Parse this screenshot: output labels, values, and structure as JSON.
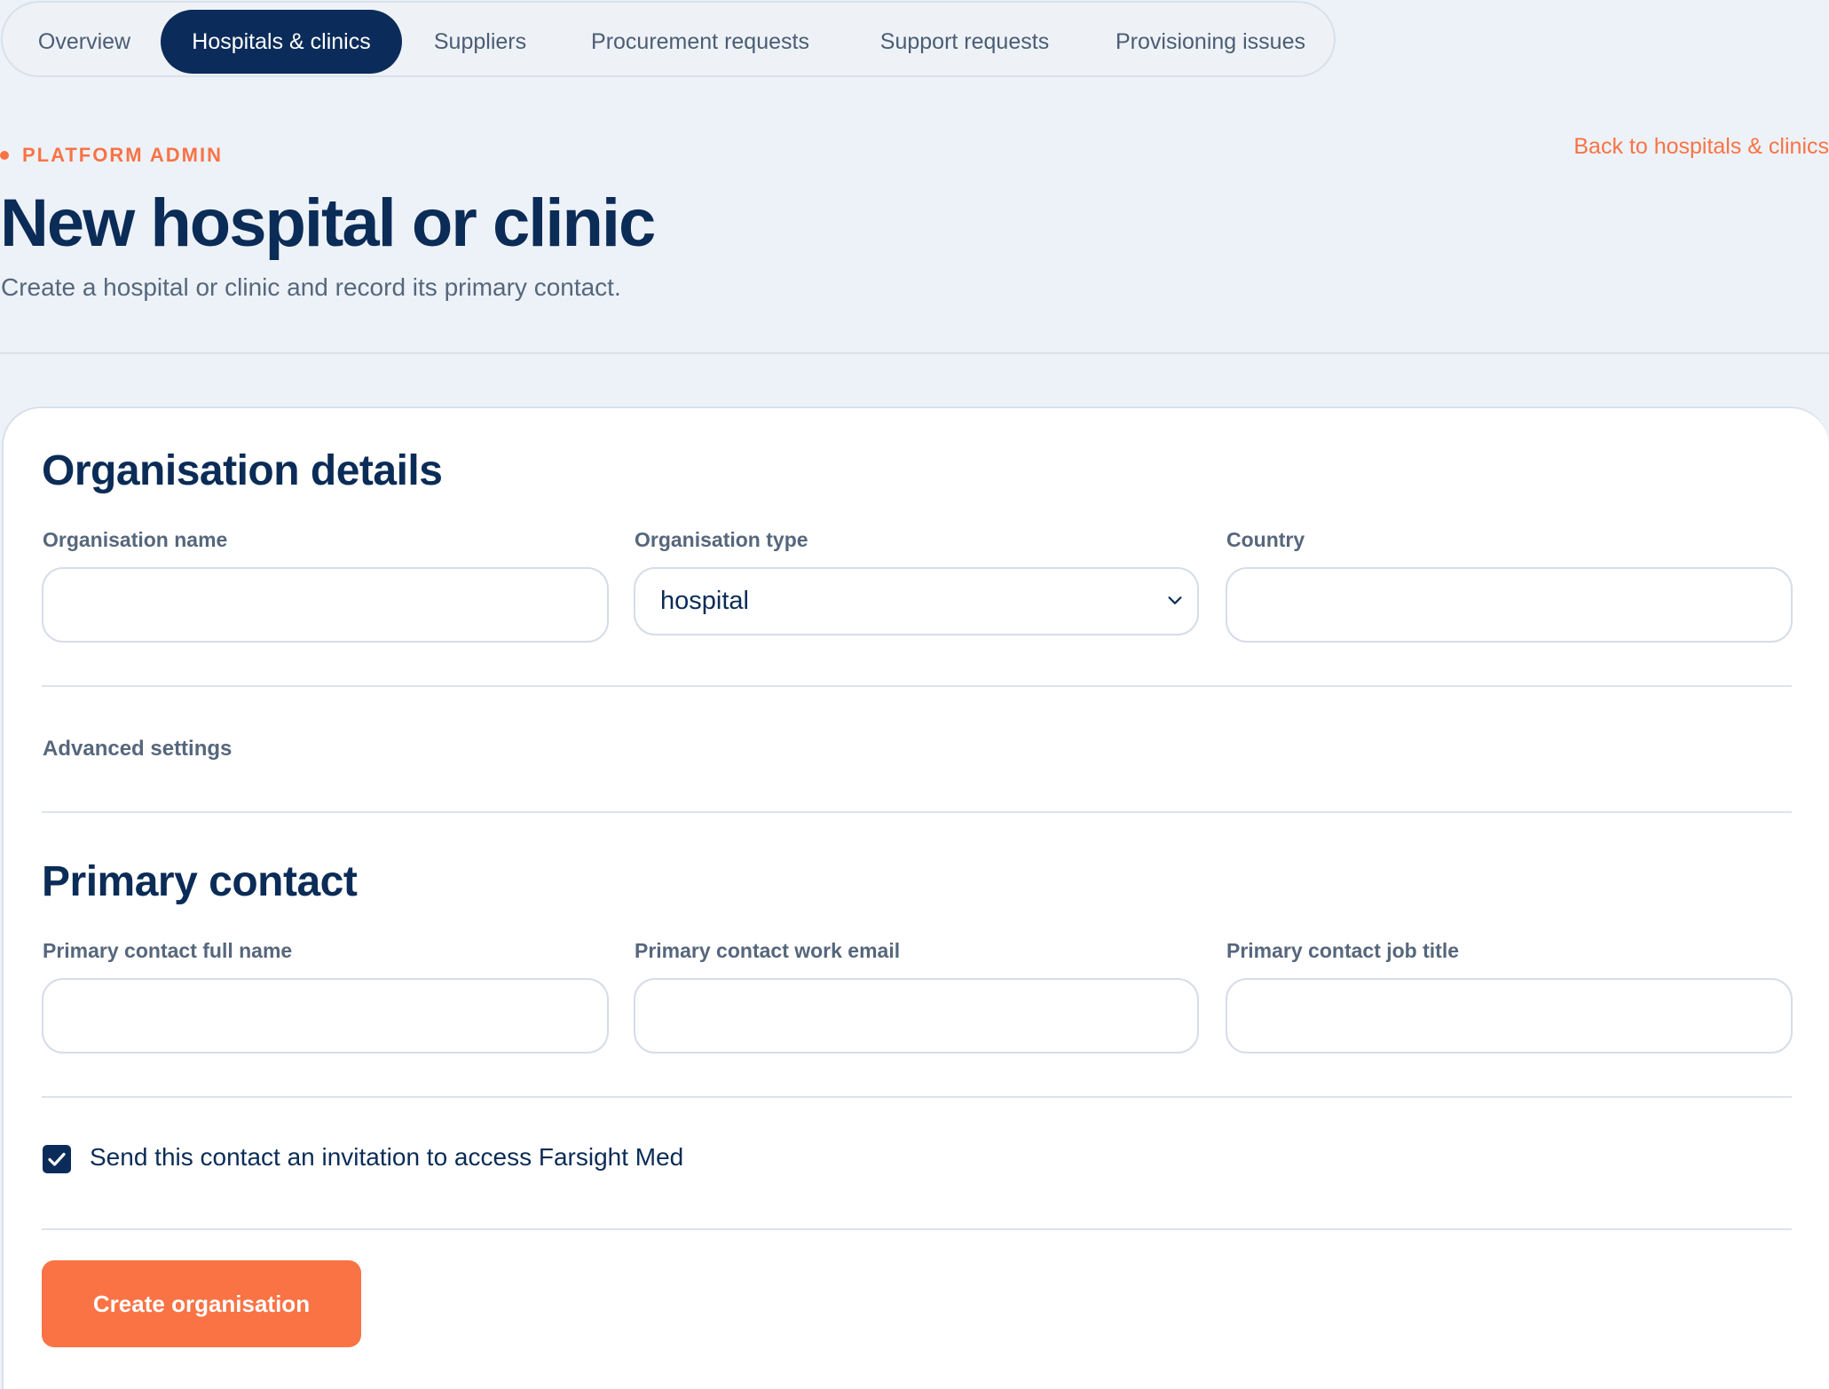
{
  "nav": {
    "tabs": [
      {
        "label": "Overview",
        "active": false
      },
      {
        "label": "Hospitals & clinics",
        "active": true
      },
      {
        "label": "Suppliers",
        "active": false
      },
      {
        "label": "Procurement requests",
        "active": false
      },
      {
        "label": "Support requests",
        "active": false
      },
      {
        "label": "Provisioning issues",
        "active": false
      }
    ]
  },
  "header": {
    "eyebrow": "PLATFORM ADMIN",
    "title": "New hospital or clinic",
    "subtitle": "Create a hospital or clinic and record its primary contact.",
    "back_link": "Back to hospitals & clinics"
  },
  "organisation": {
    "section_title": "Organisation details",
    "name_label": "Organisation name",
    "name_value": "",
    "type_label": "Organisation type",
    "type_value": "hospital",
    "country_label": "Country",
    "country_value": "",
    "advanced_label": "Advanced settings"
  },
  "contact": {
    "section_title": "Primary contact",
    "full_name_label": "Primary contact full name",
    "full_name_value": "",
    "email_label": "Primary contact work email",
    "email_value": "",
    "job_title_label": "Primary contact job title",
    "job_title_value": ""
  },
  "invite": {
    "checked": true,
    "label": "Send this contact an invitation to access Farsight Med"
  },
  "actions": {
    "submit_label": "Create organisation"
  },
  "colors": {
    "accent": "#f97345",
    "navy": "#0b2c5a",
    "muted_text": "#56677c",
    "page_background": "#edf2f8"
  },
  "icons": {
    "select": "chevron-down-icon",
    "checkbox": "checkmark-icon"
  }
}
